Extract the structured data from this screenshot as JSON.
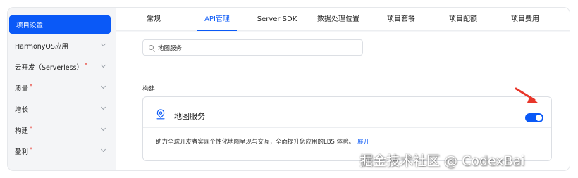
{
  "sidebar": {
    "items": [
      {
        "label": "项目设置",
        "active": true,
        "chevron": false,
        "required": false
      },
      {
        "label": "HarmonyOS应用",
        "active": false,
        "chevron": true,
        "required": false
      },
      {
        "label": "云开发（Serverless）",
        "active": false,
        "chevron": true,
        "required": true
      },
      {
        "label": "质量",
        "active": false,
        "chevron": true,
        "required": true
      },
      {
        "label": "增长",
        "active": false,
        "chevron": true,
        "required": false
      },
      {
        "label": "构建",
        "active": false,
        "chevron": true,
        "required": true
      },
      {
        "label": "盈利",
        "active": false,
        "chevron": true,
        "required": true
      }
    ],
    "required_mark": "*"
  },
  "tabs": [
    {
      "label": "常规",
      "active": false
    },
    {
      "label": "API管理",
      "active": true
    },
    {
      "label": "Server SDK",
      "active": false
    },
    {
      "label": "数据处理位置",
      "active": false
    },
    {
      "label": "项目套餐",
      "active": false
    },
    {
      "label": "项目配额",
      "active": false
    },
    {
      "label": "项目费用",
      "active": false
    }
  ],
  "search": {
    "value": "地图服务",
    "icon": "search-icon"
  },
  "section": {
    "label": "构建"
  },
  "card": {
    "icon": "map-pin-icon",
    "title": "地图服务",
    "toggle_on": true,
    "description": "助力全球开发者实现个性化地图呈现与交互，全面提升您应用的LBS 体验。",
    "expand_label": "展开"
  },
  "watermark": "掘金技术社区 @ CodexBai",
  "colors": {
    "accent": "#0a59f7",
    "required": "#e8362a",
    "arrow": "#e8362a"
  }
}
